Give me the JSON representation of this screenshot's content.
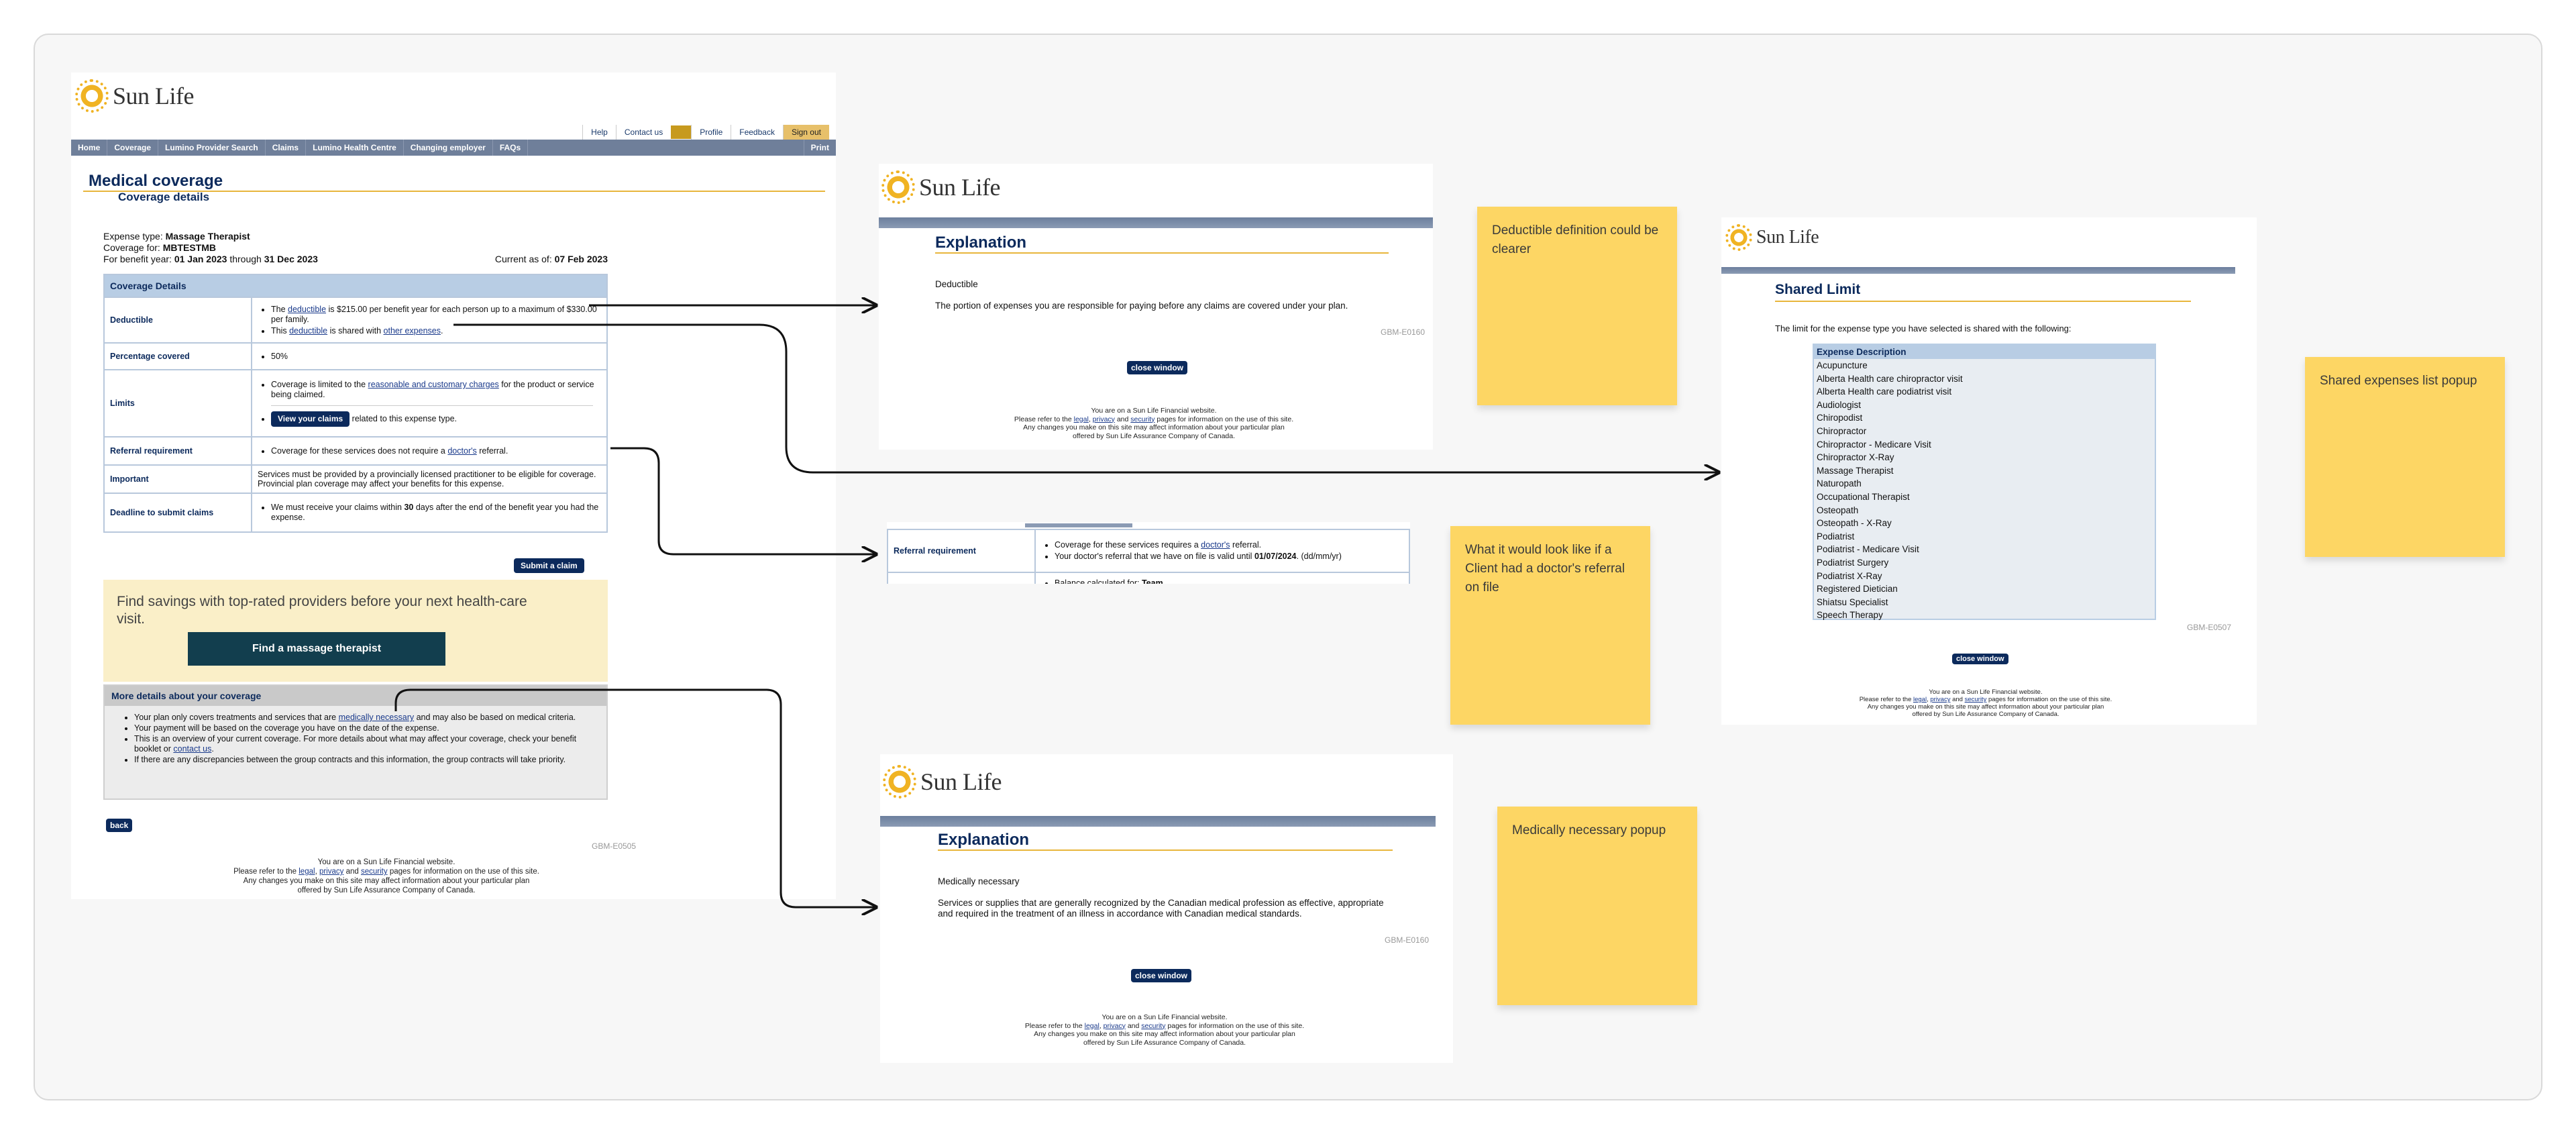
{
  "brand": {
    "name": "Sun Life"
  },
  "main": {
    "top_links": [
      "Help",
      "Contact us",
      "Profile",
      "Feedback",
      "Sign out"
    ],
    "nav": [
      "Home",
      "Coverage",
      "Lumino Provider Search",
      "Claims",
      "Lumino Health Centre",
      "Changing employer",
      "FAQs",
      "Print"
    ],
    "title": "Medical coverage",
    "subtitle": "Coverage details",
    "expense_type_label": "Expense type:",
    "expense_type": "Massage Therapist",
    "coverage_for_label": "Coverage for:",
    "coverage_for": "MBTESTMB",
    "benefit_year_label": "For benefit year:",
    "benefit_year_start": "01 Jan 2023",
    "through": "through",
    "benefit_year_end": "31 Dec 2023",
    "current_as_of_label": "Current as of:",
    "current_as_of": "07 Feb 2023",
    "table_header": "Coverage Details",
    "rows": {
      "deductible_label": "Deductible",
      "deductible_1a": "The",
      "deductible_link": "deductible",
      "deductible_1b": "is $215.00 per benefit year for each person up to a maximum of $330.00 per family.",
      "deductible_2a": "This",
      "deductible_2b": "is shared with",
      "other_expenses_link": "other expenses",
      "percentage_label": "Percentage covered",
      "percentage_value": "50%",
      "limits_label": "Limits",
      "limits_text_a": "Coverage is limited to the",
      "limits_link": "reasonable and customary charges",
      "limits_text_b": "for the product or service being claimed.",
      "view_claims_button": "View your claims",
      "view_claims_suffix": "related to this expense type.",
      "referral_label": "Referral requirement",
      "referral_text_a": "Coverage for these services does not require a",
      "referral_link": "doctor's",
      "referral_text_b": "referral.",
      "important_label": "Important",
      "important_text": "Services must be provided by a provincially licensed practitioner to be eligible for coverage. Provincial plan coverage may affect your benefits for this expense.",
      "deadline_label": "Deadline to submit claims",
      "deadline_text_a": "We must receive your claims within",
      "deadline_days": "30",
      "deadline_text_b": "days after the end of the benefit year you had the expense."
    },
    "submit_claim_button": "Submit a claim",
    "promo_text": "Find savings with top-rated providers before your next health-care visit.",
    "promo_button": "Find a massage therapist",
    "more_header": "More details about your coverage",
    "more_1a": "Your plan only covers treatments and services that are",
    "more_1_link": "medically necessary",
    "more_1b": "and may also be based on medical criteria.",
    "more_2": "Your payment will be based on the coverage you have on the date of the expense.",
    "more_3a": "This is an overview of your current coverage. For more details about what may affect your coverage, check your benefit booklet or",
    "more_3_link": "contact us",
    "more_4": "If there are any discrepancies between the group contracts and this information, the group contracts will take priority.",
    "back_button": "back",
    "code": "GBM-E0505"
  },
  "footer": {
    "line1": "You are on a Sun Life Financial website.",
    "line2a": "Please refer to the",
    "legal": "legal",
    "privacy": "privacy",
    "and": "and",
    "security": "security",
    "line2b": "pages for information on the use of this site.",
    "line3": "Any changes you make on this site may affect information about your particular plan",
    "line4": "offered by Sun Life Assurance Company of Canada."
  },
  "popup_deductible": {
    "title": "Explanation",
    "term": "Deductible",
    "definition": "The portion of expenses you are responsible for paying before any claims are covered under your plan.",
    "code": "GBM-E0160",
    "close_button": "close window"
  },
  "popup_referral": {
    "label": "Referral requirement",
    "text_a": "Coverage for these services requires a",
    "link": "doctor's",
    "text_b": "referral.",
    "valid_text_a": "Your doctor's referral that we have on file is valid until",
    "valid_date": "01/07/2024",
    "valid_format": "(dd/mm/yr)",
    "balance_a": "Balance calculated for:",
    "balance_b": "Team"
  },
  "popup_medical": {
    "title": "Explanation",
    "term": "Medically necessary",
    "definition": "Services or supplies that are generally recognized by the Canadian medical profession as effective, appropriate and required in the treatment of an illness in accordance with Canadian medical standards.",
    "code": "GBM-E0160",
    "close_button": "close window"
  },
  "popup_shared": {
    "title": "Shared Limit",
    "intro": "The limit for the expense type you have selected is shared with the following:",
    "list_header": "Expense Description",
    "items": [
      "Acupuncture",
      "Alberta Health care chiropractor visit",
      "Alberta Health care podiatrist visit",
      "Audiologist",
      "Chiropodist",
      "Chiropractor",
      "Chiropractor - Medicare Visit",
      "Chiropractor X-Ray",
      "Massage Therapist",
      "Naturopath",
      "Occupational Therapist",
      "Osteopath",
      "Osteopath - X-Ray",
      "Podiatrist",
      "Podiatrist - Medicare Visit",
      "Podiatrist Surgery",
      "Podiatrist X-Ray",
      "Registered Dietician",
      "Shiatsu Specialist",
      "Speech Therapy"
    ],
    "code": "GBM-E0507",
    "close_button": "close window"
  },
  "notes": {
    "deductible": "Deductible definition could be clearer",
    "referral": "What it would look like if a Client had a doctor's referral on file",
    "medical": "Medically necessary popup",
    "shared": "Shared expenses list popup"
  },
  "colors": {
    "navy": "#0c2a5c",
    "gold": "#e8b63c",
    "sticky": "#fdd664",
    "table_border": "#b8c8dc"
  }
}
